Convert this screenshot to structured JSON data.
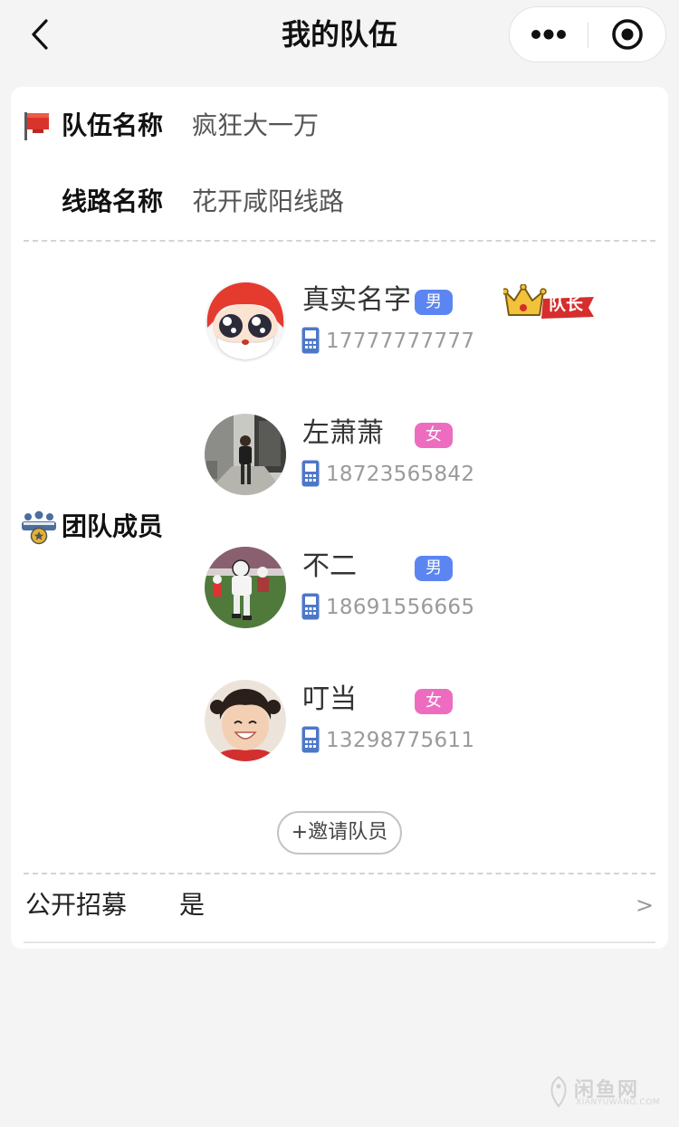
{
  "header": {
    "title": "我的队伍",
    "back_icon": "chevron-left-icon",
    "more_icon": "more-dots-icon",
    "close_icon": "target-circle-icon"
  },
  "team": {
    "name_label": "队伍名称",
    "name_value": "疯狂大一万",
    "route_label": "线路名称",
    "route_value": "花开咸阳线路",
    "members_label": "团队成员"
  },
  "members": [
    {
      "name": "真实名字",
      "gender": "男",
      "phone": "17777777777",
      "badge": "队长"
    },
    {
      "name": "左萧萧",
      "gender": "女",
      "phone": "18723565842"
    },
    {
      "name": "不二",
      "gender": "男",
      "phone": "18691556665"
    },
    {
      "name": "叮当",
      "gender": "女",
      "phone": "13298775611"
    }
  ],
  "invite_label": "+邀请队员",
  "recruit": {
    "label": "公开招募",
    "value": "是",
    "arrow": ">"
  },
  "watermark": {
    "text": "闲鱼网",
    "sub": "XIANYUWANG.COM"
  },
  "colors": {
    "male": "#5b86f2",
    "female": "#ee6cc0",
    "phone_icon": "#4d78c8",
    "flag_red": "#d9342b"
  }
}
